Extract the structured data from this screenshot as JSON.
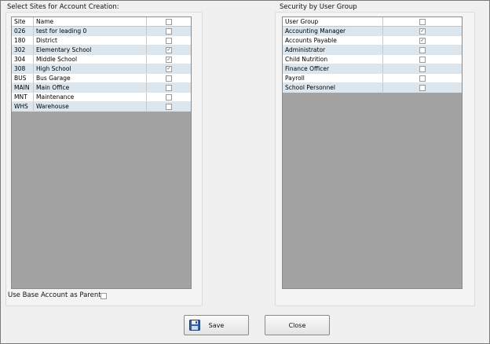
{
  "left": {
    "title": "Select Sites for Account Creation:",
    "columns": [
      "Site",
      "Name",
      ""
    ],
    "rows": [
      {
        "site": "026",
        "name": "test for leading 0",
        "checked": false
      },
      {
        "site": "180",
        "name": "District",
        "checked": false
      },
      {
        "site": "302",
        "name": "Elementary School",
        "checked": true
      },
      {
        "site": "304",
        "name": "Middle School",
        "checked": true
      },
      {
        "site": "308",
        "name": "High School",
        "checked": true
      },
      {
        "site": "BUS",
        "name": "Bus Garage",
        "checked": false
      },
      {
        "site": "MAIN",
        "name": "Main Office",
        "checked": false
      },
      {
        "site": "MNT",
        "name": "Maintenance",
        "checked": false
      },
      {
        "site": "WHS",
        "name": "Warehouse",
        "checked": false
      }
    ],
    "use_base_label": "Use Base Account as Parent",
    "use_base_checked": false
  },
  "right": {
    "title": "Security by User Group",
    "columns": [
      "User Group",
      ""
    ],
    "rows": [
      {
        "group": "Accounting Manager",
        "checked": true
      },
      {
        "group": "Accounts Payable",
        "checked": true
      },
      {
        "group": "Administrator",
        "checked": false
      },
      {
        "group": "Child Nutrition",
        "checked": false
      },
      {
        "group": "Finance Officer",
        "checked": false
      },
      {
        "group": "Payroll",
        "checked": false
      },
      {
        "group": "School Personnel",
        "checked": false
      }
    ]
  },
  "buttons": {
    "save_label": "Save",
    "close_label": "Close",
    "save_icon": "floppy-disk-icon"
  }
}
